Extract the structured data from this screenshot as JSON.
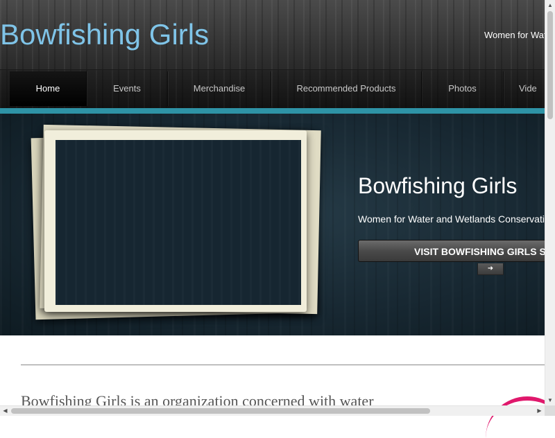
{
  "header": {
    "site_title": "Bowfishing Girls",
    "tagline": "Women for Wat"
  },
  "nav": {
    "items": [
      {
        "label": "Home",
        "active": true
      },
      {
        "label": "Events"
      },
      {
        "label": "Merchandise"
      },
      {
        "label": "Recommended Products"
      },
      {
        "label": "Photos"
      },
      {
        "label": "Vide"
      }
    ]
  },
  "hero": {
    "title": "Bowfishing Girls",
    "subtitle": "Women for Water and Wetlands Conservati",
    "button_label": "VISIT BOWFISHING GIRLS S",
    "arrow_icon": "arrow-right-icon"
  },
  "content": {
    "intro": "Bowfishing Girls is an organization concerned with water"
  },
  "scrollbars": {
    "up_arrow": "▲",
    "down_arrow": "▼",
    "left_arrow": "◀",
    "right_arrow": "▶"
  },
  "colors": {
    "title_blue": "#7fc4e8",
    "teal_accent": "#2e93a6",
    "pink_accent": "#e0186c",
    "hero_background": "#172731"
  }
}
